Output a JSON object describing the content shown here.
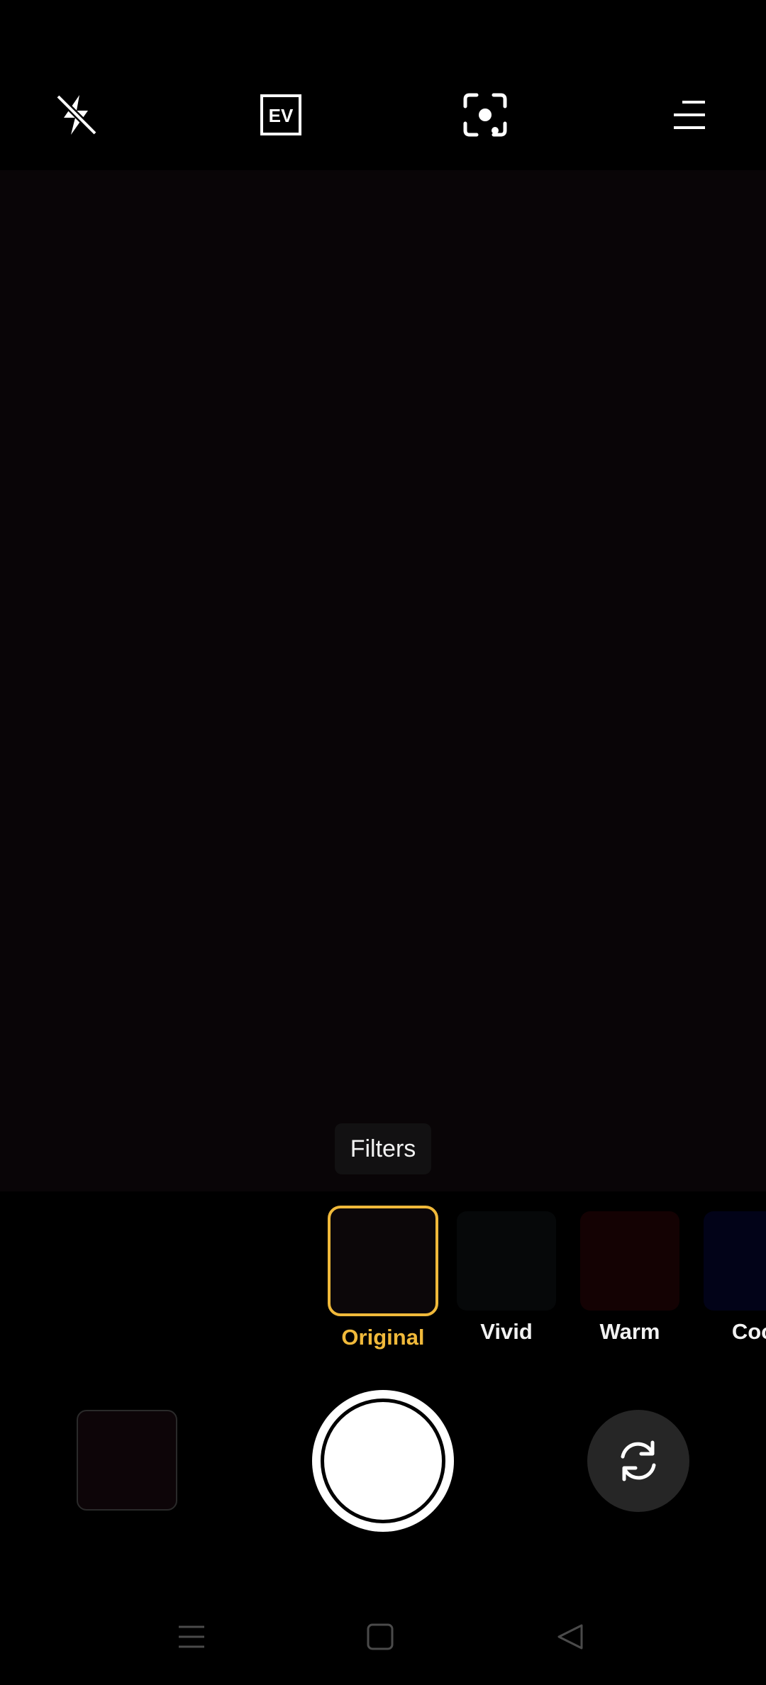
{
  "top_bar": {
    "icons": [
      "flash-off-icon",
      "exposure-ev-icon",
      "focus-target-icon",
      "menu-icon"
    ],
    "ev_text": "EV"
  },
  "viewfinder": {
    "tooltip": "Filters"
  },
  "filters": {
    "items": [
      {
        "label": "Original",
        "selected": true,
        "color": "#0c0709"
      },
      {
        "label": "Vivid",
        "selected": false,
        "color": "#060809"
      },
      {
        "label": "Warm",
        "selected": false,
        "color": "#140203"
      },
      {
        "label": "Coo",
        "selected": false,
        "color": "#020318"
      }
    ],
    "accent_color": "#f0b93a"
  },
  "bottom_controls": {
    "gallery": "gallery-thumbnail",
    "shutter": "shutter-button-icon",
    "switch": "switch-camera-icon"
  },
  "nav_bar": {
    "icons": [
      "recent-apps-icon",
      "home-icon",
      "back-icon"
    ]
  }
}
